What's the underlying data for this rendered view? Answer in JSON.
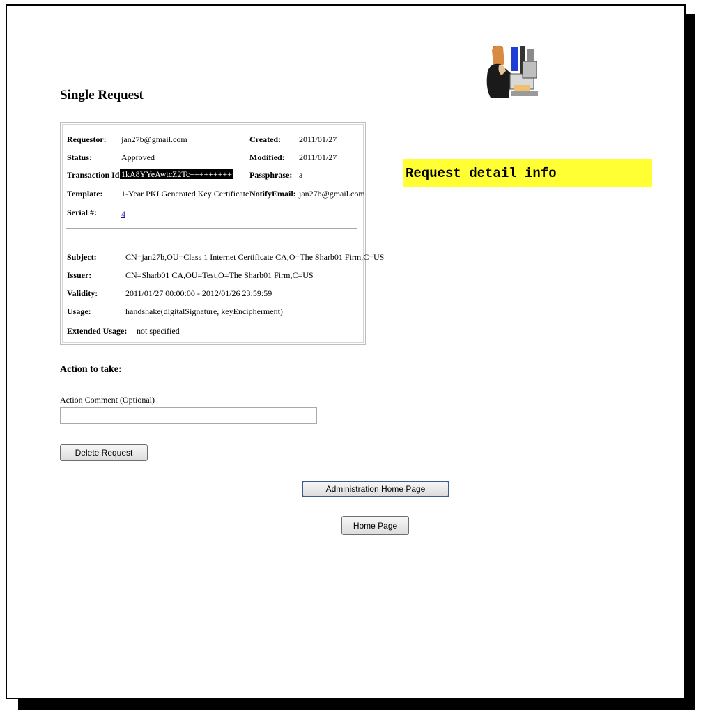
{
  "page": {
    "title": "Single Request",
    "callout": "Request detail info"
  },
  "details": {
    "requestor_label": "Requestor:",
    "requestor_value": "jan27b@gmail.com",
    "status_label": "Status:",
    "status_value": "Approved",
    "transaction_label": "Transaction Id:",
    "transaction_value": "1kA8YYeAwtcZ2Tc+++++++++",
    "template_label": "Template:",
    "template_value": "1-Year PKI Generated Key Certificate",
    "serial_label": "Serial #:",
    "serial_value": "4",
    "created_label": "Created:",
    "created_value": "2011/01/27",
    "modified_label": "Modified:",
    "modified_value": "2011/01/27",
    "passphrase_label": "Passphrase:",
    "passphrase_value": "a",
    "notify_label": "NotifyEmail:",
    "notify_value": "jan27b@gmail.com",
    "subject_label": "Subject:",
    "subject_value": "CN=jan27b,OU=Class 1 Internet Certificate CA,O=The Sharb01 Firm,C=US",
    "issuer_label": "Issuer:",
    "issuer_value": "CN=Sharb01 CA,OU=Test,O=The Sharb01 Firm,C=US",
    "validity_label": "Validity:",
    "validity_value": "2011/01/27 00:00:00 - 2012/01/26 23:59:59",
    "usage_label": "Usage:",
    "usage_value": "handshake(digitalSignature, keyEncipherment)",
    "ext_usage_label": "Extended Usage:",
    "ext_usage_value": "not specified"
  },
  "action": {
    "title": "Action to take:",
    "comment_label": "Action Comment (Optional)",
    "comment_value": "",
    "delete_button": "Delete Request"
  },
  "nav": {
    "admin_home_button": "Administration Home Page",
    "home_button": "Home Page"
  },
  "icons": {
    "logo": "pki-administrator-illustration"
  }
}
